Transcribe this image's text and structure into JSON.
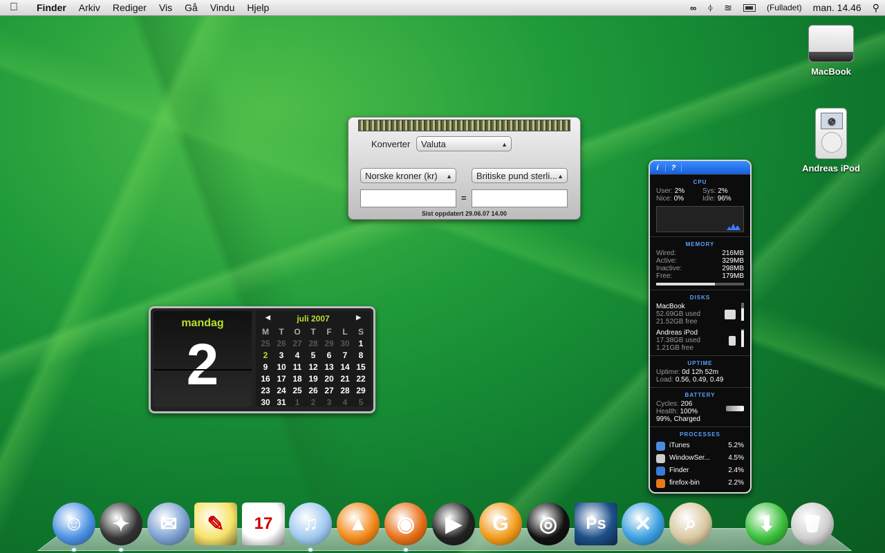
{
  "menubar": {
    "app": "Finder",
    "menus": [
      "Arkiv",
      "Rediger",
      "Vis",
      "Gå",
      "Vindu",
      "Hjelp"
    ],
    "battery_status": "(Fulladet)",
    "clock": "man. 14.46"
  },
  "desktop_icons": [
    {
      "label": "MacBook"
    },
    {
      "label": "Andreas iPod"
    }
  ],
  "currency_widget": {
    "convert_label": "Konverter",
    "type_value": "Valuta",
    "from_value": "Norske kroner (kr)",
    "to_value": "Britiske pund sterli...",
    "equals": "=",
    "updated": "Sist oppdatert 29.06.07 14.00"
  },
  "calendar_widget": {
    "day_name": "mandag",
    "day_number": "2",
    "month": "juli 2007",
    "weekday_headers": [
      "M",
      "T",
      "O",
      "T",
      "F",
      "L",
      "S"
    ],
    "weeks": [
      [
        "25",
        "26",
        "27",
        "28",
        "29",
        "30",
        "1"
      ],
      [
        "2",
        "3",
        "4",
        "5",
        "6",
        "7",
        "8"
      ],
      [
        "9",
        "10",
        "11",
        "12",
        "13",
        "14",
        "15"
      ],
      [
        "16",
        "17",
        "18",
        "19",
        "20",
        "21",
        "22"
      ],
      [
        "23",
        "24",
        "25",
        "26",
        "27",
        "28",
        "29"
      ],
      [
        "30",
        "31",
        "1",
        "2",
        "3",
        "4",
        "5"
      ]
    ]
  },
  "istat": {
    "cpu": {
      "title": "CPU",
      "user_label": "User:",
      "user": "2%",
      "sys_label": "Sys:",
      "sys": "2%",
      "nice_label": "Nice:",
      "nice": "0%",
      "idle_label": "Idle:",
      "idle": "96%"
    },
    "memory": {
      "title": "MEMORY",
      "wired_label": "Wired:",
      "wired": "216MB",
      "active_label": "Active:",
      "active": "329MB",
      "inactive_label": "Inactive:",
      "inactive": "298MB",
      "free_label": "Free:",
      "free": "179MB",
      "used_fraction": 0.67
    },
    "disks": {
      "title": "DISKS",
      "items": [
        {
          "name": "MacBook",
          "used": "52.69GB used",
          "free": "21.52GB free",
          "fill": 0.71
        },
        {
          "name": "Andreas iPod",
          "used": "17.38GB used",
          "free": "1.21GB free",
          "fill": 0.93
        }
      ]
    },
    "uptime": {
      "title": "UPTIME",
      "uptime_label": "Uptime:",
      "uptime": "0d 12h 52m",
      "load_label": "Load:",
      "load": "0.56, 0.49, 0.49"
    },
    "battery": {
      "title": "BATTERY",
      "cycles_label": "Cycles:",
      "cycles": "206",
      "health_label": "Health:",
      "health": "100%",
      "status": "99%, Charged"
    },
    "processes": {
      "title": "PROCESSES",
      "items": [
        {
          "name": "iTunes",
          "cpu": "5.2%",
          "color": "#4a8be0"
        },
        {
          "name": "WindowSer...",
          "cpu": "4.5%",
          "color": "#cccccc"
        },
        {
          "name": "Finder",
          "cpu": "2.4%",
          "color": "#3a7bd5"
        },
        {
          "name": "firefox-bin",
          "cpu": "2.2%",
          "color": "#e87a1a"
        }
      ]
    }
  },
  "dock": [
    {
      "name": "finder",
      "color": "#4a90e2",
      "glyph": "☺",
      "running": true
    },
    {
      "name": "dashboard",
      "color": "#333333",
      "glyph": "✦",
      "running": true
    },
    {
      "name": "mail",
      "color": "#7aa0d0",
      "glyph": "✉",
      "running": false
    },
    {
      "name": "stickies",
      "color": "#f7e36a",
      "glyph": "✎",
      "running": false
    },
    {
      "name": "ical",
      "color": "#ffffff",
      "glyph": "17",
      "running": false
    },
    {
      "name": "itunes",
      "color": "#9ec9f0",
      "glyph": "♫",
      "running": true
    },
    {
      "name": "vlc",
      "color": "#f28a1a",
      "glyph": "▲",
      "running": false
    },
    {
      "name": "firefox",
      "color": "#e8701a",
      "glyph": "◉",
      "running": true
    },
    {
      "name": "ichat",
      "color": "#222222",
      "glyph": "▶",
      "running": false
    },
    {
      "name": "garageband",
      "color": "#f29a1a",
      "glyph": "G",
      "running": false
    },
    {
      "name": "camera",
      "color": "#111111",
      "glyph": "◎",
      "running": false
    },
    {
      "name": "photoshop",
      "color": "#1c4f8a",
      "glyph": "Ps",
      "running": false
    },
    {
      "name": "xcode",
      "color": "#3aa0e0",
      "glyph": "✕",
      "running": false
    },
    {
      "name": "preview",
      "color": "#d8c8a0",
      "glyph": "⌕",
      "running": false
    },
    {
      "name": "downloads",
      "color": "#3ac03a",
      "glyph": "⬇",
      "running": false
    },
    {
      "name": "trash",
      "color": "#cfcfcf",
      "glyph": "🗑",
      "running": false
    }
  ]
}
